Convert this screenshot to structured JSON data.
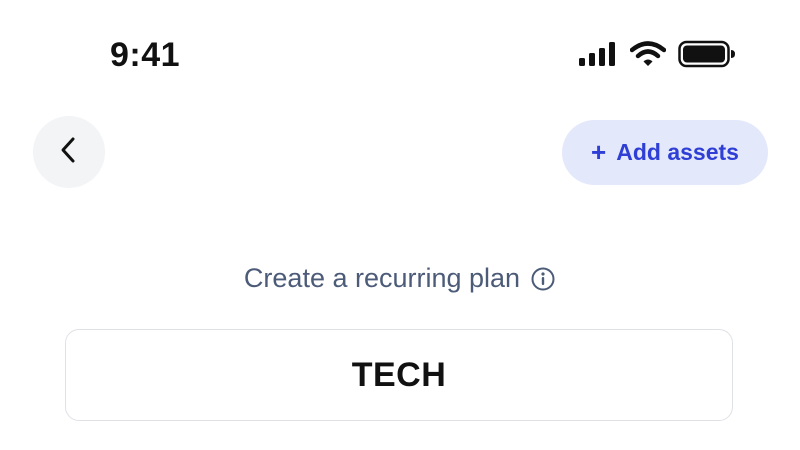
{
  "status_bar": {
    "time": "9:41",
    "icons": [
      "cellular-signal-icon",
      "wifi-icon",
      "battery-icon"
    ]
  },
  "header": {
    "back_icon": "chevron-left-icon",
    "add_assets": {
      "icon": "plus-icon",
      "icon_glyph": "+",
      "label": "Add assets"
    }
  },
  "plan": {
    "label": "Create a recurring plan",
    "info_icon": "info-icon",
    "name_value": "TECH"
  },
  "colors": {
    "accent": "#2f3fd6",
    "accent_bg": "#e3e8fb",
    "muted_text": "#4c5b78",
    "back_bg": "#f3f4f6"
  }
}
